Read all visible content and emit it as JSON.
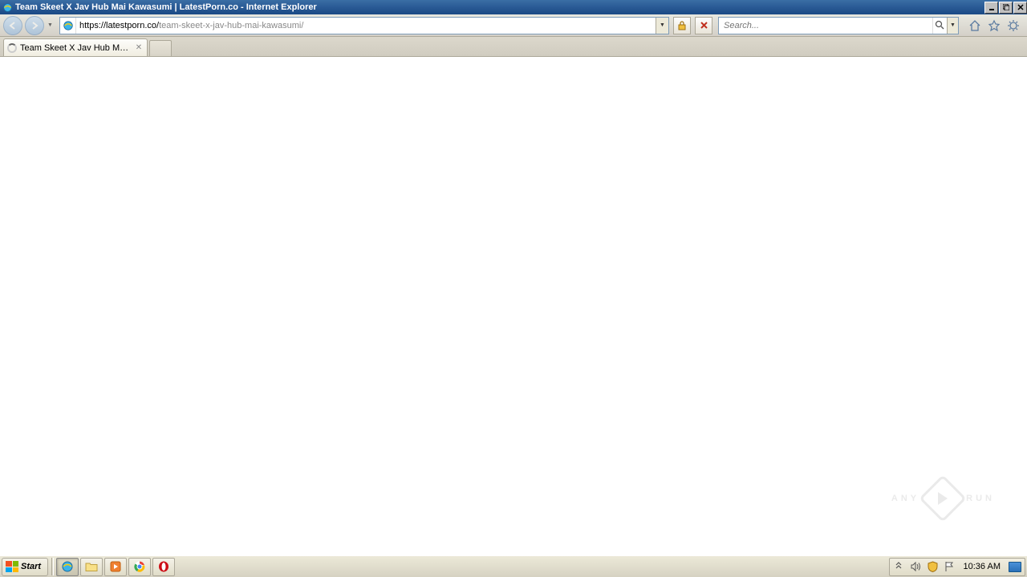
{
  "window": {
    "title": "Team Skeet X Jav Hub Mai Kawasumi | LatestPorn.co - Internet Explorer"
  },
  "nav": {
    "url_domain": "https://latestporn.co/",
    "url_path": "team-skeet-x-jav-hub-mai-kawasumi/",
    "search_placeholder": "Search..."
  },
  "tabs": [
    {
      "label": "Team Skeet X Jav Hub Mai K..."
    }
  ],
  "watermark": {
    "left": "ANY",
    "right": "RUN"
  },
  "taskbar": {
    "start_label": "Start",
    "clock": "10:36 AM"
  }
}
